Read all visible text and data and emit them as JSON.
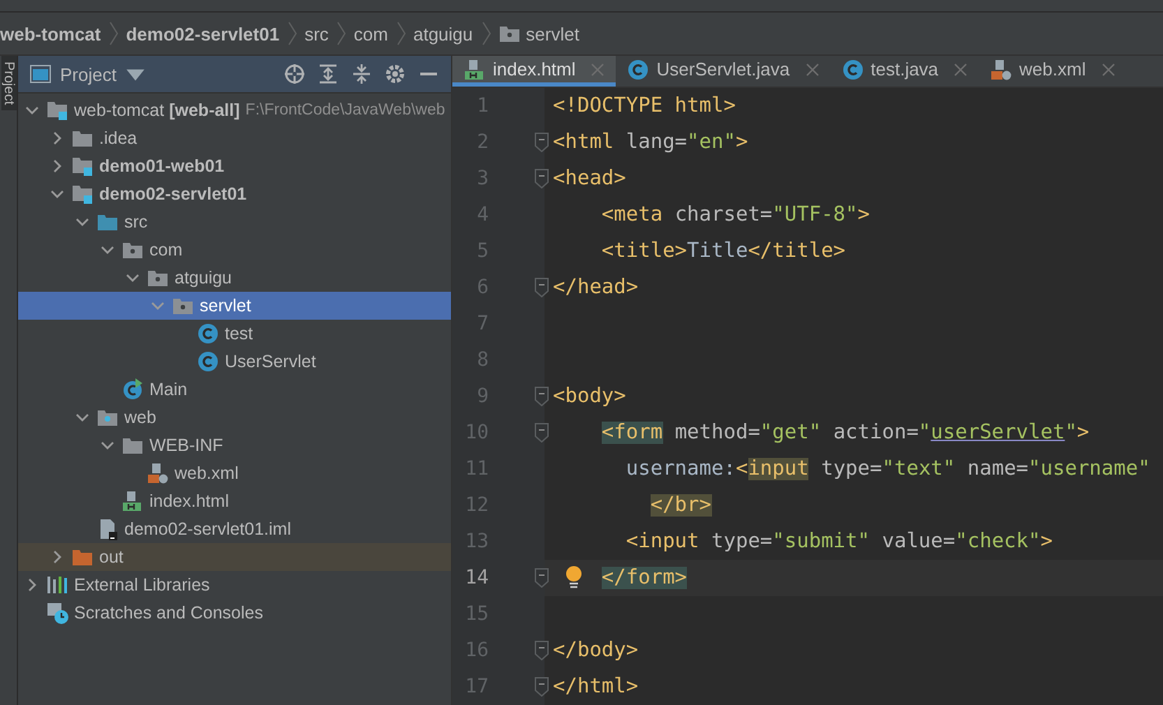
{
  "breadcrumb": [
    {
      "label": "web-tomcat",
      "bold": true,
      "kind": "plain"
    },
    {
      "label": "demo02-servlet01",
      "bold": true,
      "kind": "plain"
    },
    {
      "label": "src",
      "bold": false,
      "kind": "plain"
    },
    {
      "label": "com",
      "bold": false,
      "kind": "plain"
    },
    {
      "label": "atguigu",
      "bold": false,
      "kind": "plain"
    },
    {
      "label": "servlet",
      "bold": false,
      "kind": "package"
    }
  ],
  "side_strip": {
    "label": "Project"
  },
  "project_panel": {
    "title": "Project",
    "tree": [
      {
        "label": "web-tomcat **[web-all]**",
        "hint": "F:\\FrontCode\\JavaWeb\\web",
        "kind": "module",
        "bold": false,
        "expanded": true,
        "selected": false,
        "excluded": false,
        "children": [
          {
            "label": ".idea",
            "kind": "folder",
            "bold": false,
            "expanded": false,
            "selected": false,
            "excluded": false
          },
          {
            "label": "demo01-web01",
            "kind": "module",
            "bold": true,
            "expanded": false,
            "selected": false,
            "excluded": false
          },
          {
            "label": "demo02-servlet01",
            "kind": "module",
            "bold": true,
            "expanded": true,
            "selected": false,
            "excluded": false,
            "children": [
              {
                "label": "src",
                "kind": "source",
                "bold": false,
                "expanded": true,
                "selected": false,
                "excluded": false,
                "children": [
                  {
                    "label": "com",
                    "kind": "package",
                    "bold": false,
                    "expanded": true,
                    "selected": false,
                    "excluded": false,
                    "children": [
                      {
                        "label": "atguigu",
                        "kind": "package",
                        "bold": false,
                        "expanded": true,
                        "selected": false,
                        "excluded": false,
                        "children": [
                          {
                            "label": "servlet",
                            "kind": "package",
                            "bold": false,
                            "expanded": true,
                            "selected": true,
                            "excluded": false,
                            "children": [
                              {
                                "label": "test",
                                "kind": "class",
                                "bold": false,
                                "selected": false,
                                "excluded": false
                              },
                              {
                                "label": "UserServlet",
                                "kind": "class",
                                "bold": false,
                                "selected": false,
                                "excluded": false
                              }
                            ]
                          }
                        ]
                      }
                    ]
                  },
                  {
                    "label": "Main",
                    "kind": "main",
                    "bold": false,
                    "selected": false,
                    "excluded": false
                  }
                ]
              },
              {
                "label": "web",
                "kind": "web",
                "bold": false,
                "expanded": true,
                "selected": false,
                "excluded": false,
                "children": [
                  {
                    "label": "WEB-INF",
                    "kind": "folder",
                    "bold": false,
                    "expanded": true,
                    "selected": false,
                    "excluded": false,
                    "children": [
                      {
                        "label": "web.xml",
                        "kind": "xml",
                        "bold": false,
                        "selected": false,
                        "excluded": false
                      }
                    ]
                  },
                  {
                    "label": "index.html",
                    "kind": "html",
                    "bold": false,
                    "selected": false,
                    "excluded": false
                  }
                ]
              },
              {
                "label": "demo02-servlet01.iml",
                "kind": "iml",
                "bold": false,
                "selected": false,
                "excluded": false
              }
            ]
          },
          {
            "label": "out",
            "kind": "excluded-folder",
            "bold": false,
            "expanded": false,
            "selected": false,
            "excluded": true
          }
        ]
      },
      {
        "label": "External Libraries",
        "kind": "libraries",
        "bold": false,
        "expanded": false,
        "selected": false,
        "excluded": false
      },
      {
        "label": "Scratches and Consoles",
        "kind": "scratches",
        "bold": false,
        "selected": false,
        "excluded": false
      }
    ]
  },
  "tabs": [
    {
      "label": "index.html",
      "kind": "html",
      "selected": true
    },
    {
      "label": "UserServlet.java",
      "kind": "class",
      "selected": false
    },
    {
      "label": "test.java",
      "kind": "class",
      "selected": false
    },
    {
      "label": "web.xml",
      "kind": "xml",
      "selected": false
    }
  ],
  "editor": {
    "lines": [
      {
        "number": "1",
        "fold": false,
        "current": false,
        "bulb": false,
        "tokens": [
          {
            "kind": "tag",
            "text": "<!DOCTYPE html>"
          }
        ]
      },
      {
        "number": "2",
        "fold": true,
        "current": false,
        "bulb": false,
        "tokens": [
          {
            "kind": "tag",
            "text": "<html "
          },
          {
            "kind": "attr",
            "text": "lang="
          },
          {
            "kind": "value",
            "text": "\"en\""
          },
          {
            "kind": "tag",
            "text": ">"
          }
        ]
      },
      {
        "number": "3",
        "fold": true,
        "current": false,
        "bulb": false,
        "tokens": [
          {
            "kind": "tag",
            "text": "<head>"
          }
        ]
      },
      {
        "number": "4",
        "fold": false,
        "current": false,
        "bulb": false,
        "tokens": [
          {
            "kind": "tag",
            "text": "    <meta "
          },
          {
            "kind": "attr",
            "text": "charset="
          },
          {
            "kind": "value",
            "text": "\"UTF-8\""
          },
          {
            "kind": "tag",
            "text": ">"
          }
        ]
      },
      {
        "number": "5",
        "fold": false,
        "current": false,
        "bulb": false,
        "tokens": [
          {
            "kind": "tag",
            "text": "    <title>"
          },
          {
            "kind": "text",
            "text": "Title"
          },
          {
            "kind": "tag",
            "text": "</title>"
          }
        ]
      },
      {
        "number": "6",
        "fold": true,
        "current": false,
        "bulb": false,
        "tokens": [
          {
            "kind": "tag",
            "text": "</head>"
          }
        ]
      },
      {
        "number": "7",
        "fold": false,
        "current": false,
        "bulb": false
      },
      {
        "number": "8",
        "fold": false,
        "current": false,
        "bulb": false
      },
      {
        "number": "9",
        "fold": true,
        "current": false,
        "bulb": false,
        "tokens": [
          {
            "kind": "tag",
            "text": "<body>"
          }
        ]
      },
      {
        "number": "10",
        "fold": true,
        "current": false,
        "bulb": false,
        "tokens": [
          {
            "kind": "match",
            "text": "    <form"
          },
          {
            "kind": "attr",
            "text": " method="
          },
          {
            "kind": "value",
            "text": "\"get\""
          },
          {
            "kind": "attr",
            "text": " action="
          },
          {
            "kind": "value",
            "text": "\""
          },
          {
            "kind": "link",
            "text": "userServlet"
          },
          {
            "kind": "value",
            "text": "\""
          },
          {
            "kind": "tag",
            "text": ">"
          }
        ]
      },
      {
        "number": "11",
        "fold": false,
        "current": false,
        "bulb": false,
        "tokens": [
          {
            "kind": "text",
            "text": "      username:"
          },
          {
            "kind": "tag",
            "text": "<"
          },
          {
            "kind": "warn",
            "text": "input"
          },
          {
            "kind": "attr",
            "text": " type="
          },
          {
            "kind": "value",
            "text": "\"text\""
          },
          {
            "kind": "attr",
            "text": " name="
          },
          {
            "kind": "value",
            "text": "\"username\""
          }
        ]
      },
      {
        "number": "12",
        "fold": false,
        "current": false,
        "bulb": false,
        "tokens": [
          {
            "kind": "warn",
            "text": "        </br>"
          }
        ]
      },
      {
        "number": "13",
        "fold": false,
        "current": false,
        "bulb": false,
        "tokens": [
          {
            "kind": "tag",
            "text": "      <input "
          },
          {
            "kind": "attr",
            "text": "type="
          },
          {
            "kind": "value",
            "text": "\"submit\""
          },
          {
            "kind": "attr",
            "text": " value="
          },
          {
            "kind": "value",
            "text": "\"check\""
          },
          {
            "kind": "tag",
            "text": ">"
          }
        ]
      },
      {
        "number": "14",
        "fold": true,
        "current": true,
        "bulb": true,
        "tokens": [
          {
            "kind": "match",
            "text": "    </form>"
          }
        ]
      },
      {
        "number": "15",
        "fold": false,
        "current": false,
        "bulb": false
      },
      {
        "number": "16",
        "fold": true,
        "current": false,
        "bulb": false,
        "tokens": [
          {
            "kind": "tag",
            "text": "</body>"
          }
        ]
      },
      {
        "number": "17",
        "fold": true,
        "current": false,
        "bulb": false,
        "tokens": [
          {
            "kind": "tag",
            "text": "</html>"
          }
        ]
      }
    ]
  }
}
